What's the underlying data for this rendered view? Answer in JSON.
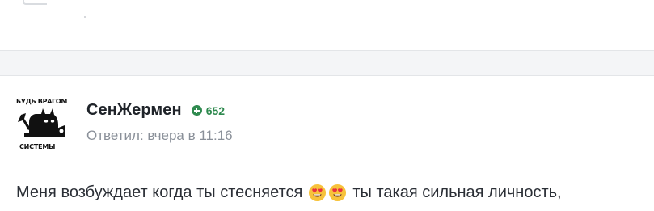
{
  "post": {
    "author": "СенЖермен",
    "reputation": "652",
    "meta": "Ответил: вчера в 11:16",
    "avatar": {
      "top_text": "БУДЬ ВРАГОМ",
      "bottom_text": "СИСТЕМЫ"
    },
    "body": {
      "before_emoji": "Меня возбуждает когда ты стесняется",
      "emoji": [
        "smiling-face-with-heart-eyes",
        "smiling-face-with-heart-eyes"
      ],
      "after_emoji": "ты такая сильная личность,"
    }
  },
  "colors": {
    "reputation": "#2f8a4f",
    "author": "#1f2329",
    "meta": "#8a9099",
    "divider_bg": "#f4f5f7"
  }
}
